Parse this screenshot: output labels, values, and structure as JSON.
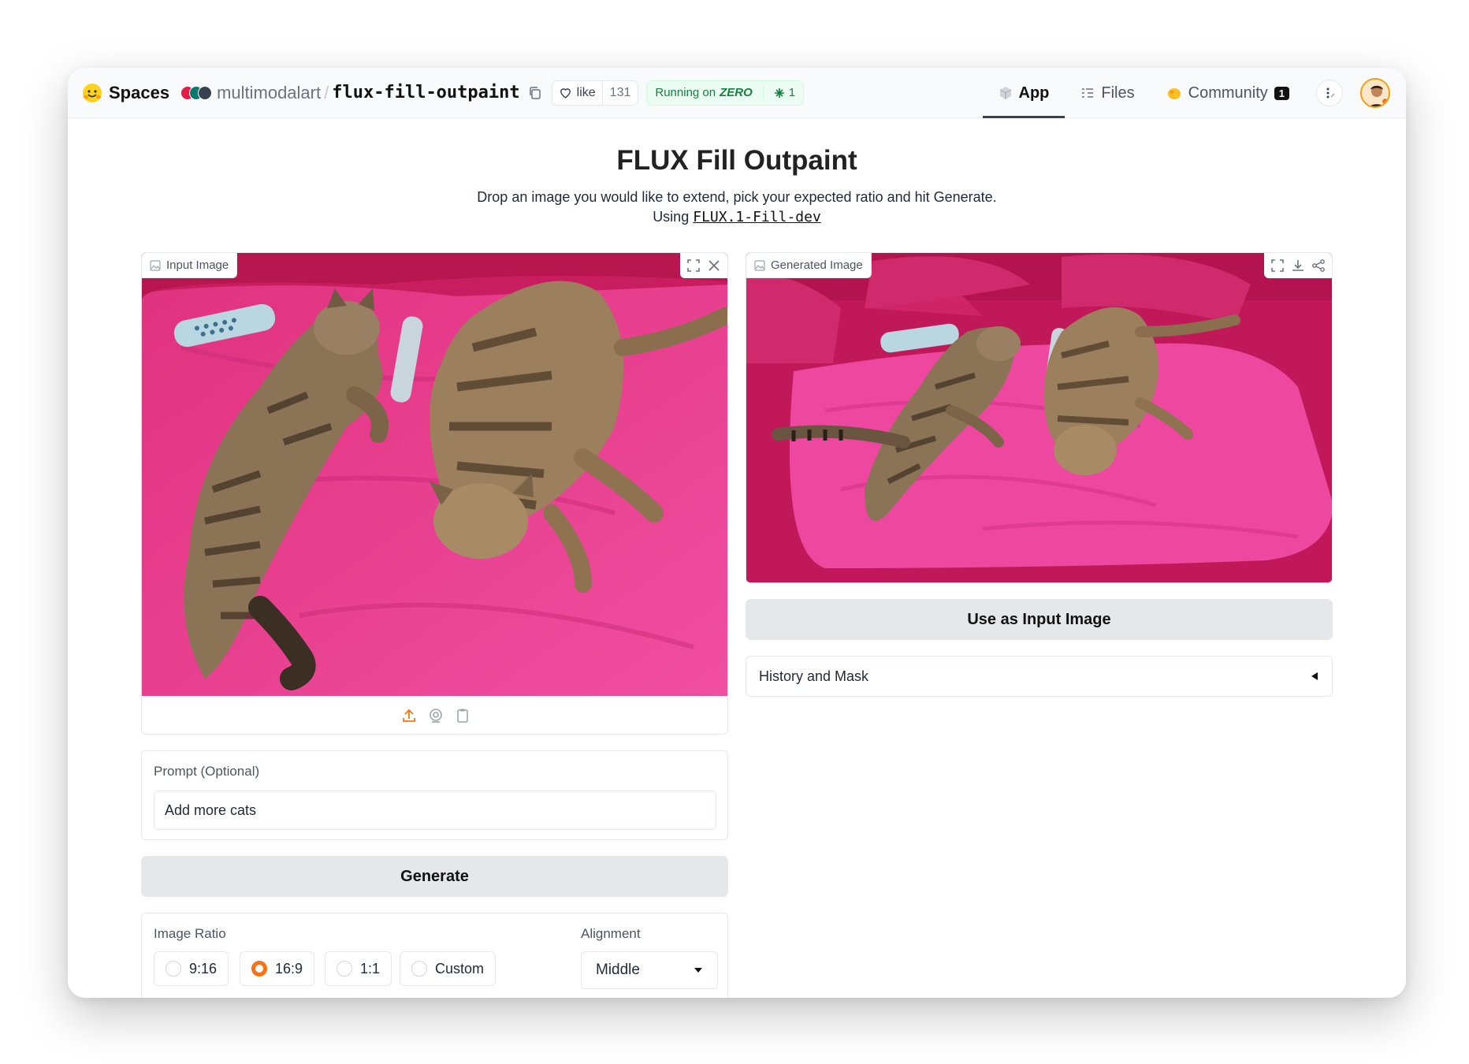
{
  "header": {
    "spaces_label": "Spaces",
    "owner": "multimodalart",
    "repo": "flux-fill-outpaint",
    "like_label": "like",
    "like_count": "131",
    "running_prefix": "Running on",
    "running_hardware": "ZERO",
    "replicas": "1",
    "tabs": [
      {
        "label": "App",
        "icon": "cube-icon",
        "active": true
      },
      {
        "label": "Files",
        "icon": "files-icon",
        "active": false
      },
      {
        "label": "Community",
        "icon": "community-icon",
        "active": false,
        "badge": "1"
      }
    ]
  },
  "main": {
    "title": "FLUX Fill Outpaint",
    "description": "Drop an image you would like to extend, pick your expected ratio and hit Generate.",
    "using_prefix": "Using",
    "model_link": "FLUX.1-Fill-dev"
  },
  "input_image": {
    "label": "Input Image",
    "tools": [
      "fullscreen-icon",
      "close-icon"
    ],
    "sources": [
      "upload-icon",
      "webcam-icon",
      "clipboard-icon"
    ]
  },
  "generated_image": {
    "label": "Generated Image",
    "tools": [
      "fullscreen-icon",
      "download-icon",
      "share-icon"
    ]
  },
  "use_as_input_button": "Use as Input Image",
  "history_accordion": {
    "label": "History and Mask",
    "state": "collapsed"
  },
  "prompt": {
    "label": "Prompt (Optional)",
    "value": "Add more cats"
  },
  "generate_button": "Generate",
  "image_ratio": {
    "label": "Image Ratio",
    "options": [
      "9:16",
      "16:9",
      "1:1",
      "Custom"
    ],
    "selected": "16:9"
  },
  "alignment": {
    "label": "Alignment",
    "value": "Middle"
  },
  "colors": {
    "accent": "#f97316",
    "running_green": "#15803d",
    "button_gray": "#e5e7eb"
  }
}
